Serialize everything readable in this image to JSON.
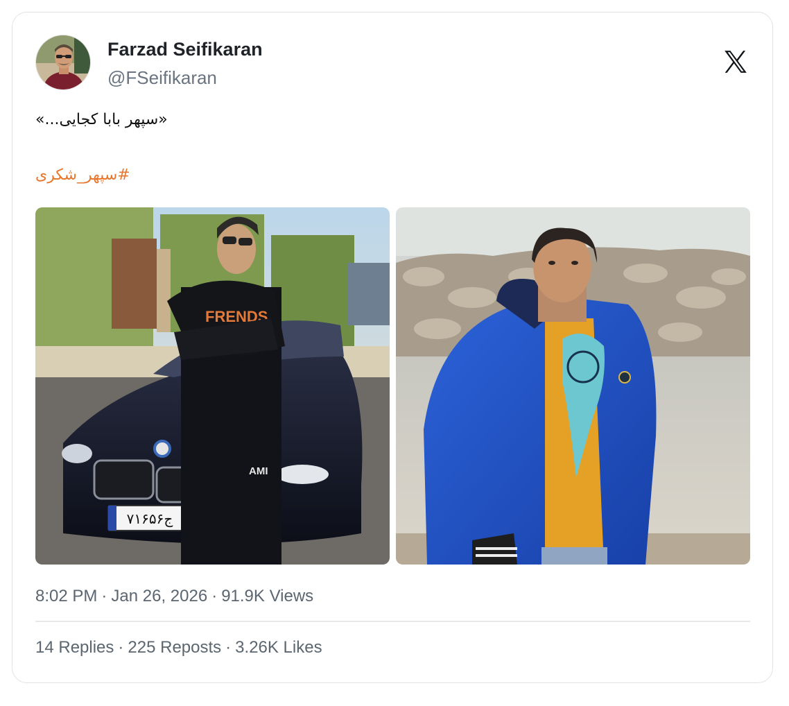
{
  "author": {
    "name": "Farzad Seifikaran",
    "handle": "@FSeifikaran"
  },
  "tweet": {
    "text": "«...سپهر بابا کجایی»",
    "hashtag": "سپهر_شکری#"
  },
  "photos": {
    "left_plate": "۷۱ج۶۵۶",
    "left_shirt": "FRENDS",
    "left_brand": "AMI"
  },
  "meta": {
    "time": "8:02 PM",
    "date": "Jan 26, 2026",
    "views": "91.9K Views"
  },
  "stats": {
    "replies": "14 Replies",
    "reposts": "225 Reposts",
    "likes": "3.26K Likes"
  },
  "colors": {
    "hashtag": "#e8772e",
    "muted": "#5b6670",
    "border": "#dfe3e6"
  },
  "icons": {
    "platform": "x-logo-icon"
  }
}
